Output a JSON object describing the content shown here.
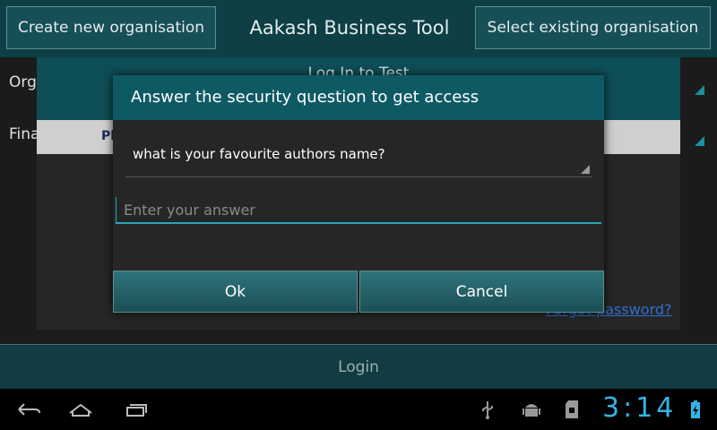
{
  "app": {
    "title": "Aakash Business Tool",
    "create_button": "Create new organisation",
    "select_button": "Select existing organisation"
  },
  "background_form": {
    "org_label": "Orga",
    "fin_label": "Fina",
    "login_dialog_title": "Log In to Test",
    "strip_text": "Pl",
    "forgot_password": "Forgot password?",
    "login_button": "Login"
  },
  "security_dialog": {
    "title": "Answer the security question to get access",
    "question": "what is your favourite authors name?",
    "answer_placeholder": "Enter your answer",
    "answer_value": "",
    "ok_label": "Ok",
    "cancel_label": "Cancel"
  },
  "system_bar": {
    "clock": "3:14"
  },
  "colors": {
    "accent": "#33b5e5",
    "header": "#0e5a64"
  }
}
